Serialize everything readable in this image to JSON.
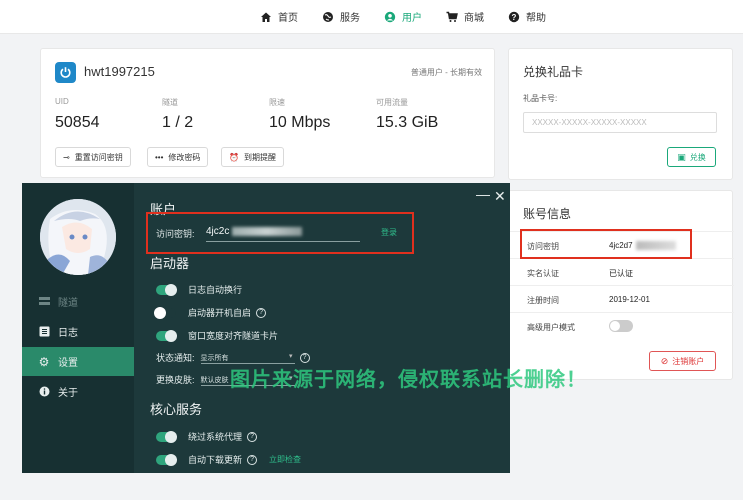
{
  "nav": {
    "items": [
      {
        "label": "首页",
        "icon": "home-icon"
      },
      {
        "label": "服务",
        "icon": "globe-icon"
      },
      {
        "label": "用户",
        "icon": "user-icon"
      },
      {
        "label": "商城",
        "icon": "cart-icon"
      },
      {
        "label": "帮助",
        "icon": "question-icon"
      }
    ],
    "active": "用户",
    "accent": "#1aa87a"
  },
  "user": {
    "username": "hwt1997215",
    "plan": "普通用户 - 长期有效",
    "stats": [
      {
        "label": "UID",
        "value": "50854"
      },
      {
        "label": "隧道",
        "value": "1 / 2"
      },
      {
        "label": "限速",
        "value": "10 Mbps"
      },
      {
        "label": "可用流量",
        "value": "15.3 GiB"
      }
    ],
    "buttons": [
      {
        "label": "重置访问密钥",
        "icon": "key-icon"
      },
      {
        "label": "修改密码",
        "icon": "dots-icon"
      },
      {
        "label": "到期提醒",
        "icon": "alarm-icon"
      }
    ]
  },
  "gift": {
    "title": "兑换礼品卡",
    "card_label": "礼品卡号:",
    "placeholder": "XXXXX-XXXXX-XXXXX-XXXXX",
    "redeem": "兑换"
  },
  "account": {
    "title": "账号信息",
    "rows": [
      {
        "key": "访问密钥",
        "value": "4jc2d7"
      },
      {
        "key": "实名认证",
        "value": "已认证"
      },
      {
        "key": "注册时间",
        "value": "2019-12-01"
      },
      {
        "key": "高级用户模式",
        "value": ""
      }
    ],
    "advanced_mode": false,
    "cancel": "注销账户"
  },
  "client": {
    "sidebar": [
      {
        "label": "隧道",
        "icon": "tunnel-icon",
        "state": "disabled"
      },
      {
        "label": "日志",
        "icon": "log-icon",
        "state": "normal"
      },
      {
        "label": "设置",
        "icon": "gear-icon",
        "state": "active"
      },
      {
        "label": "关于",
        "icon": "info-icon",
        "state": "normal"
      }
    ],
    "window": {
      "minimize": "—",
      "close": "✕"
    },
    "account_section": "账户",
    "key_label": "访问密钥:",
    "key_value": "4jc2c",
    "login": "登录",
    "launcher_section": "启动器",
    "launcher_options": [
      {
        "label": "日志自动换行",
        "on": true,
        "help": false
      },
      {
        "label": "启动器开机自启",
        "on": false,
        "help": true
      },
      {
        "label": "窗口宽度对齐隧道卡片",
        "on": true,
        "help": false
      }
    ],
    "notify_label": "状态通知:",
    "notify_value": "显示所有",
    "skin_label": "更换皮肤:",
    "skin_value": "默认皮肤",
    "core_section": "核心服务",
    "core_options": [
      {
        "label": "绕过系统代理",
        "on": true,
        "help": true
      },
      {
        "label": "自动下载更新",
        "on": true,
        "help": true,
        "link": "立即检查"
      }
    ]
  },
  "watermark": "图片来源于网络，侵权联系站长删除！"
}
